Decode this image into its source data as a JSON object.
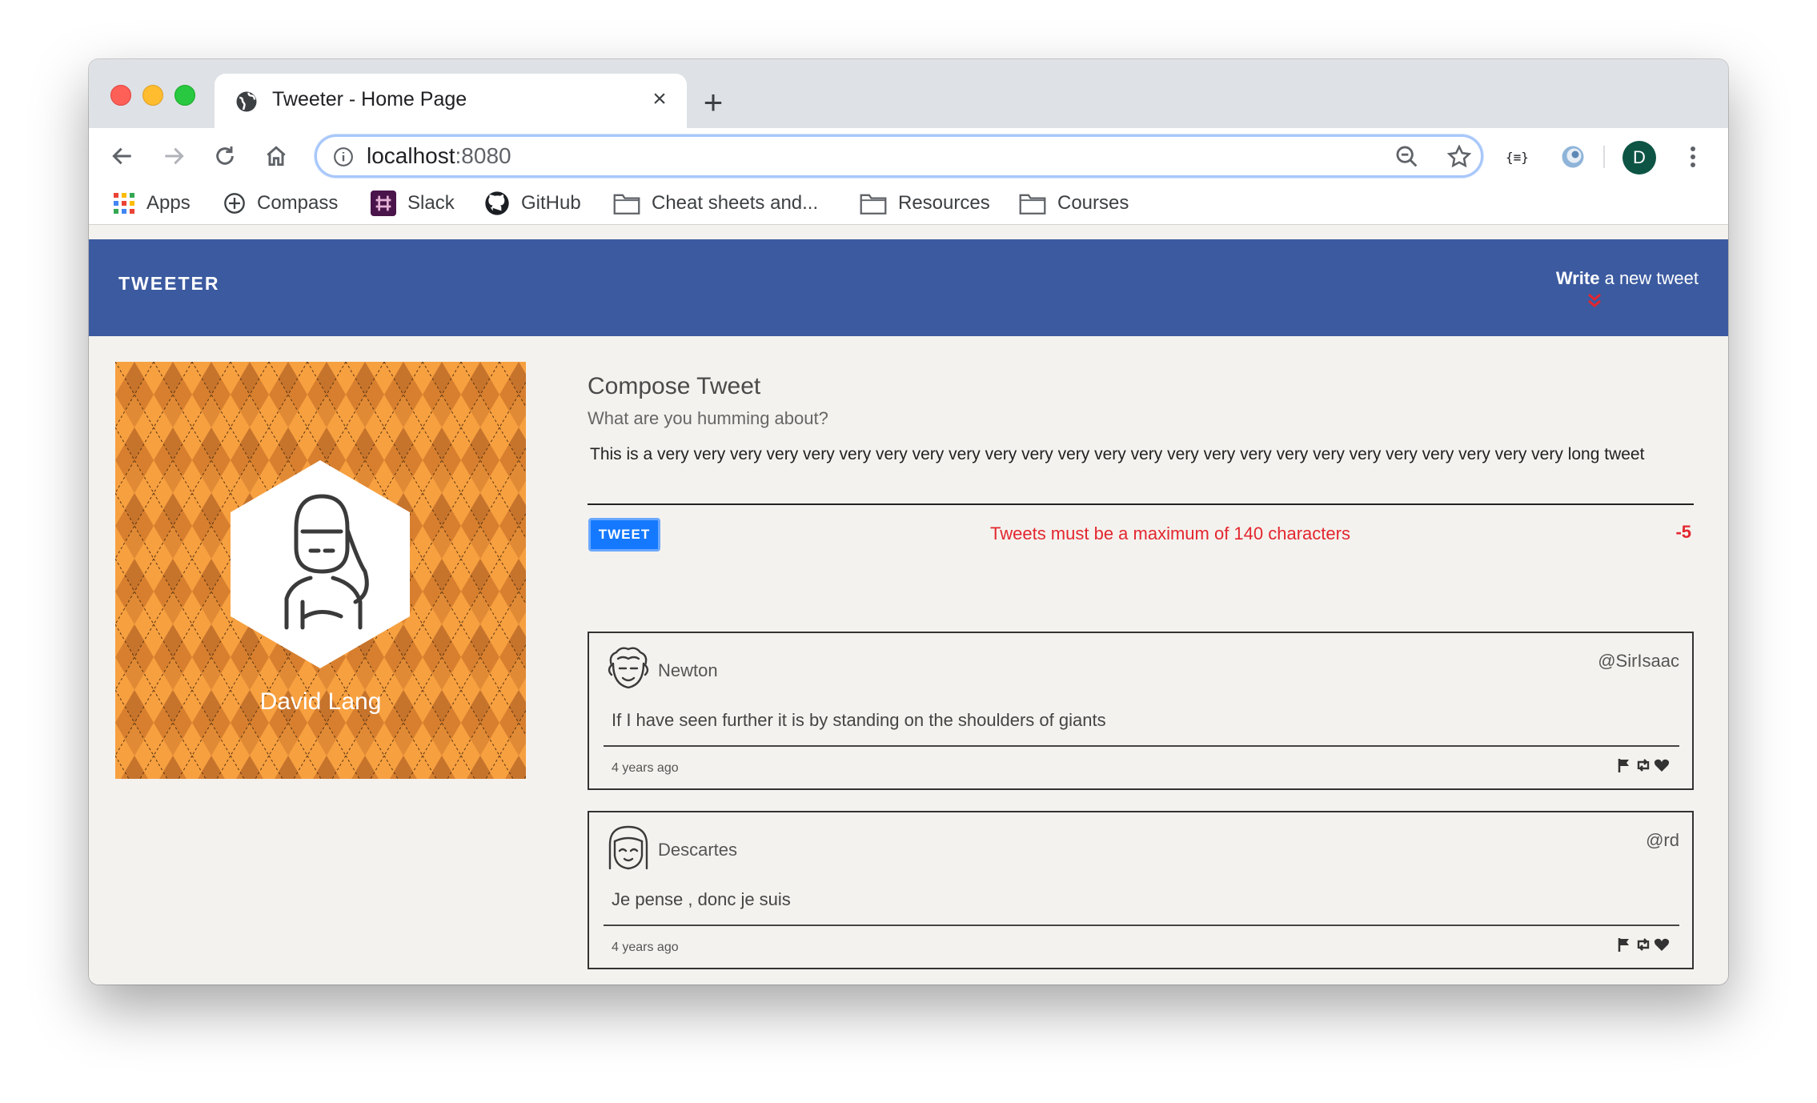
{
  "browser": {
    "tab_title": "Tweeter - Home Page",
    "tab_close": "×",
    "new_tab": "+",
    "url_host": "localhost",
    "url_port": ":8080",
    "profile_initial": "D",
    "bookmarks": [
      "Apps",
      "Compass",
      "Slack",
      "GitHub",
      "Cheat sheets and...",
      "Resources",
      "Courses"
    ]
  },
  "nav": {
    "brand": "TWEETER",
    "write_bold": "Write",
    "write_rest": " a new tweet",
    "accent_color": "#e3262f",
    "bar_color": "#3b5aa0"
  },
  "profile": {
    "name": "David Lang",
    "card_color": "#f79c3a"
  },
  "compose": {
    "title": "Compose Tweet",
    "prompt": "What are you humming about?",
    "text": "This is a very very very very very very very very very very very very very very very very very very very very very very very very very long tweet",
    "button": "TWEET",
    "error": "Tweets must be a maximum of 140 characters",
    "counter": "-5"
  },
  "tweets": [
    {
      "name": "Newton",
      "handle": "@SirIsaac",
      "content": "If I have seen further it is by standing on the shoulders of giants",
      "time": "4 years ago"
    },
    {
      "name": "Descartes",
      "handle": "@rd",
      "content": "Je pense , donc je suis",
      "time": "4 years ago"
    }
  ]
}
